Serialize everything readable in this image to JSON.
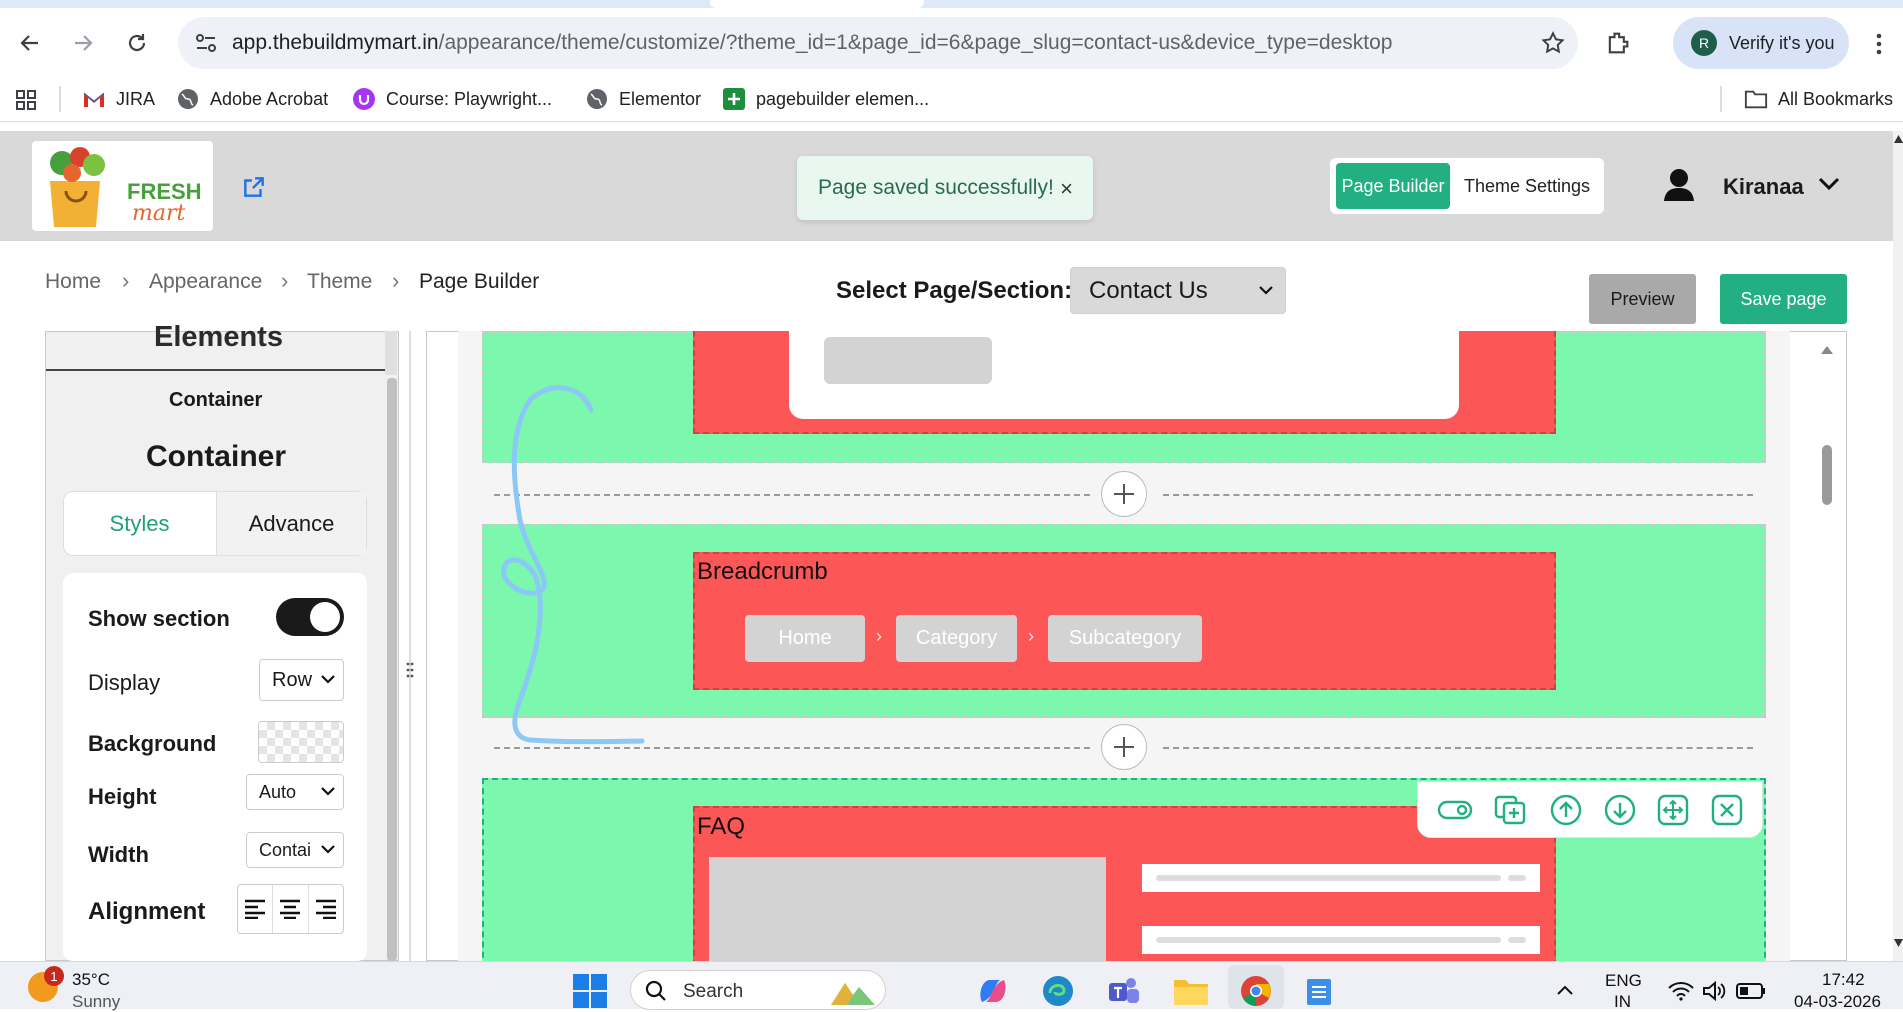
{
  "browser": {
    "url_host": "app.thebuildmymart.in",
    "url_path": "/appearance/theme/customize/?theme_id=1&page_id=6&page_slug=contact-us&device_type=desktop",
    "verify_label": "Verify it's you",
    "avatar_initial": "R",
    "bookmarks": [
      {
        "label": "JIRA"
      },
      {
        "label": "Adobe Acrobat"
      },
      {
        "label": "Course: Playwright..."
      },
      {
        "label": "Elementor"
      },
      {
        "label": "pagebuilder elemen..."
      }
    ],
    "all_bookmarks_label": "All Bookmarks"
  },
  "header": {
    "logo_text_1": "FRESH",
    "logo_text_2": "mart",
    "toast_message": "Page saved successfully!",
    "toast_close": "×",
    "mode_tabs": {
      "page_builder": "Page Builder",
      "theme_settings": "Theme Settings"
    },
    "user_name": "Kiranaa"
  },
  "breadcrumb": {
    "items": [
      "Home",
      "Appearance",
      "Theme",
      "Page Builder"
    ]
  },
  "toolbar": {
    "select_label": "Select Page/Section:",
    "selected_page": "Contact Us",
    "preview_label": "Preview",
    "save_label": "Save page"
  },
  "left_panel": {
    "title": "Elements",
    "section_name": "Container",
    "panel_heading": "Container",
    "tabs": {
      "styles": "Styles",
      "advance": "Advance"
    },
    "props": {
      "show_section": "Show section",
      "display": "Display",
      "display_value": "Row",
      "background": "Background",
      "height": "Height",
      "height_value": "Auto",
      "width": "Width",
      "width_value": "Contai",
      "alignment": "Alignment"
    }
  },
  "canvas": {
    "breadcrumb_section_label": "Breadcrumb",
    "breadcrumb_chips": [
      "Home",
      "Category",
      "Subcategory"
    ],
    "faq_section_label": "FAQ",
    "colors": {
      "section_bg": "#7bf8ad",
      "block_bg": "#fd5656",
      "accent": "#22b083"
    }
  },
  "taskbar": {
    "weather_temp": "35°C",
    "weather_desc": "Sunny",
    "weather_badge": "1",
    "search_placeholder": "Search",
    "lang_1": "ENG",
    "lang_2": "IN",
    "time": "17:42",
    "date": "04-03-2026"
  }
}
